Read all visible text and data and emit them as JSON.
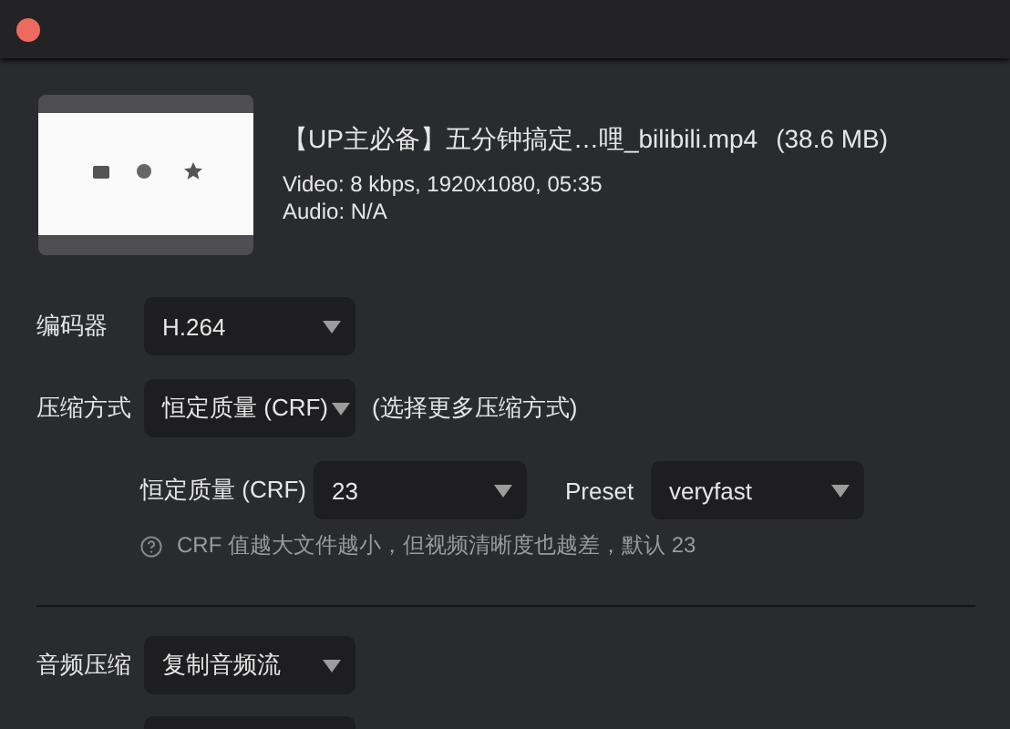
{
  "file": {
    "name": "【UP主必备】五分钟搞定…哩_bilibili.mp4",
    "size": "(38.6 MB)",
    "video": "Video: 8 kbps, 1920x1080, 05:35",
    "audio": "Audio: N/A"
  },
  "encoder": {
    "label": "编码器",
    "value": "H.264"
  },
  "compression": {
    "label": "压缩方式",
    "value": "恒定质量 (CRF)",
    "more_link": "(选择更多压缩方式)"
  },
  "crf": {
    "label": "恒定质量 (CRF)",
    "value": "23"
  },
  "preset": {
    "label": "Preset",
    "value": "veryfast"
  },
  "hint": "CRF 值越大文件越小，但视频清晰度也越差，默认 23",
  "audio_compression": {
    "label": "音频压缩",
    "value": "复制音频流"
  }
}
